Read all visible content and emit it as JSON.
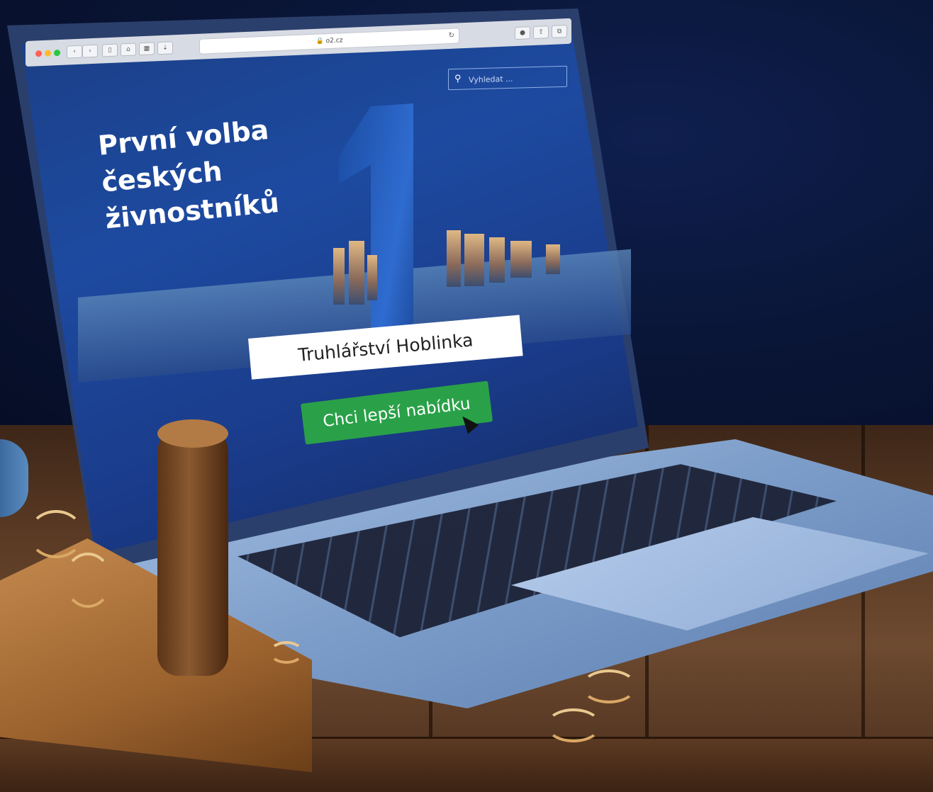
{
  "browser": {
    "url": "o2.cz",
    "reload_icon": "reload-icon",
    "toolbar_icons": [
      "back-icon",
      "forward-icon",
      "sidebar-icon",
      "home-icon",
      "grid-icon",
      "download-icon"
    ],
    "right_icons": [
      "info-icon",
      "share-icon",
      "tabs-icon"
    ]
  },
  "search": {
    "placeholder": "Vyhledat ..."
  },
  "hero": {
    "title_lines": [
      "První volba",
      "českých",
      "živnostníků"
    ],
    "big_numeral": "1"
  },
  "name_plate": "Truhlářství Hoblinka",
  "cta": {
    "label": "Chci lepší nabídku"
  },
  "colors": {
    "screen_blue": "#1d4aa0",
    "cta_green": "#2aa148",
    "laptop_body": "#8eaad4"
  }
}
